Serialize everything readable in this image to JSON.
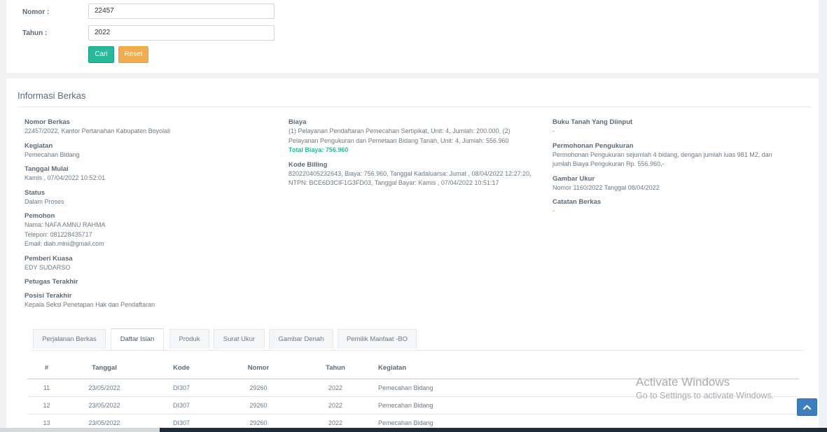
{
  "search": {
    "nomor_label": "Nomor :",
    "nomor_value": "22457",
    "tahun_label": "Tahun :",
    "tahun_value": "2022",
    "cari_label": "Cari",
    "reset_label": "Reset"
  },
  "info": {
    "title": "Informasi Berkas",
    "nomor_berkas_label": "Nomor Berkas",
    "nomor_berkas_value": "22457/2022, Kantor Pertanahan Kabupaten Boyolali",
    "kegiatan_label": "Kegiatan",
    "kegiatan_value": "Pemecahan Bidang",
    "tanggal_mulai_label": "Tanggal Mulai",
    "tanggal_mulai_value": "Kamis , 07/04/2022 10:52:01",
    "status_label": "Status",
    "status_value": "Dalam Proses",
    "pemohon_label": "Pemohon",
    "pemohon_nama": "Nama: NAFA AMNU RAHMA",
    "pemohon_telepon": "Telepon: 081228435717",
    "pemohon_email": "Email: diah.mini@gmail.com",
    "pemberi_kuasa_label": "Pemberi Kuasa",
    "pemberi_kuasa_value": "EDY SUDARSO",
    "petugas_terakhir_label": "Petugas Terakhir",
    "posisi_terakhir_label": "Posisi Terakhir",
    "posisi_terakhir_value": "Kepala Seksi Penetapan Hak dan Pendaftaran",
    "biaya_label": "Biaya",
    "biaya_line1": "(1) Pelayanan Pendaftaran Pemecahan Sertipikat, Unit: 4, Jumlah: 200.000, (2)",
    "biaya_line2": "Pelayanan Pengukuran dan Pemetaan Bidang Tanah, Unit: 4, Jumlah: 556.960",
    "total_biaya": "Total Biaya: 756.960",
    "kode_billing_label": "Kode Billing",
    "kode_billing_line1": "820220405232643, Biaya: 756.960, Tanggal Kadaluarsa: Jumat , 08/04/2022 12:27:20,",
    "kode_billing_line2": "NTPN: BCE6D3CIF1G3FD03, Tanggal Bayar: Kamis , 07/04/2022 10:51:17",
    "buku_tanah_label": "Buku Tanah Yang Diinput",
    "buku_tanah_value": "-",
    "permohonan_label": "Permohonan Pengukuran",
    "permohonan_line1": "Permohonan Pengukuran sejumlah 4 bidang, dengan jumlah luas 981 M2, dan",
    "permohonan_line2": "jumlah Biaya Pengukuran Rp. 556.960,-",
    "gambar_ukur_label": "Gambar Ukur",
    "gambar_ukur_value": "Nomor 1160/2022 Tanggal 08/04/2022",
    "catatan_label": "Catatan Berkas",
    "catatan_value": "-"
  },
  "tabs": [
    {
      "label": "Perjalanan Berkas"
    },
    {
      "label": "Daftar Isian"
    },
    {
      "label": "Produk"
    },
    {
      "label": "Surat Ukur"
    },
    {
      "label": "Gambar Denah"
    },
    {
      "label": "Pemilik Manfaat -BO"
    }
  ],
  "active_tab": "Daftar Isian",
  "table": {
    "headers": [
      "#",
      "Tanggal",
      "Kode",
      "Nomor",
      "Tahun",
      "Kegiatan"
    ],
    "rows": [
      [
        "11",
        "23/05/2022",
        "DI307",
        "29260",
        "2022",
        "Pemecahan Bidang"
      ],
      [
        "12",
        "23/05/2022",
        "DI307",
        "29260",
        "2022",
        "Pemecahan Bidang"
      ],
      [
        "13",
        "23/05/2022",
        "DI307",
        "29260",
        "2022",
        "Pemecahan Bidang"
      ]
    ]
  },
  "watermark": {
    "line1": "Activate Windows",
    "line2": "Go to Settings to activate Windows."
  },
  "icons": {
    "scroll_top": "chevron-up-icon"
  },
  "colors": {
    "primary": "#26b99a",
    "warning": "#f0ad4e",
    "scroll_button": "#3b7fc0"
  }
}
